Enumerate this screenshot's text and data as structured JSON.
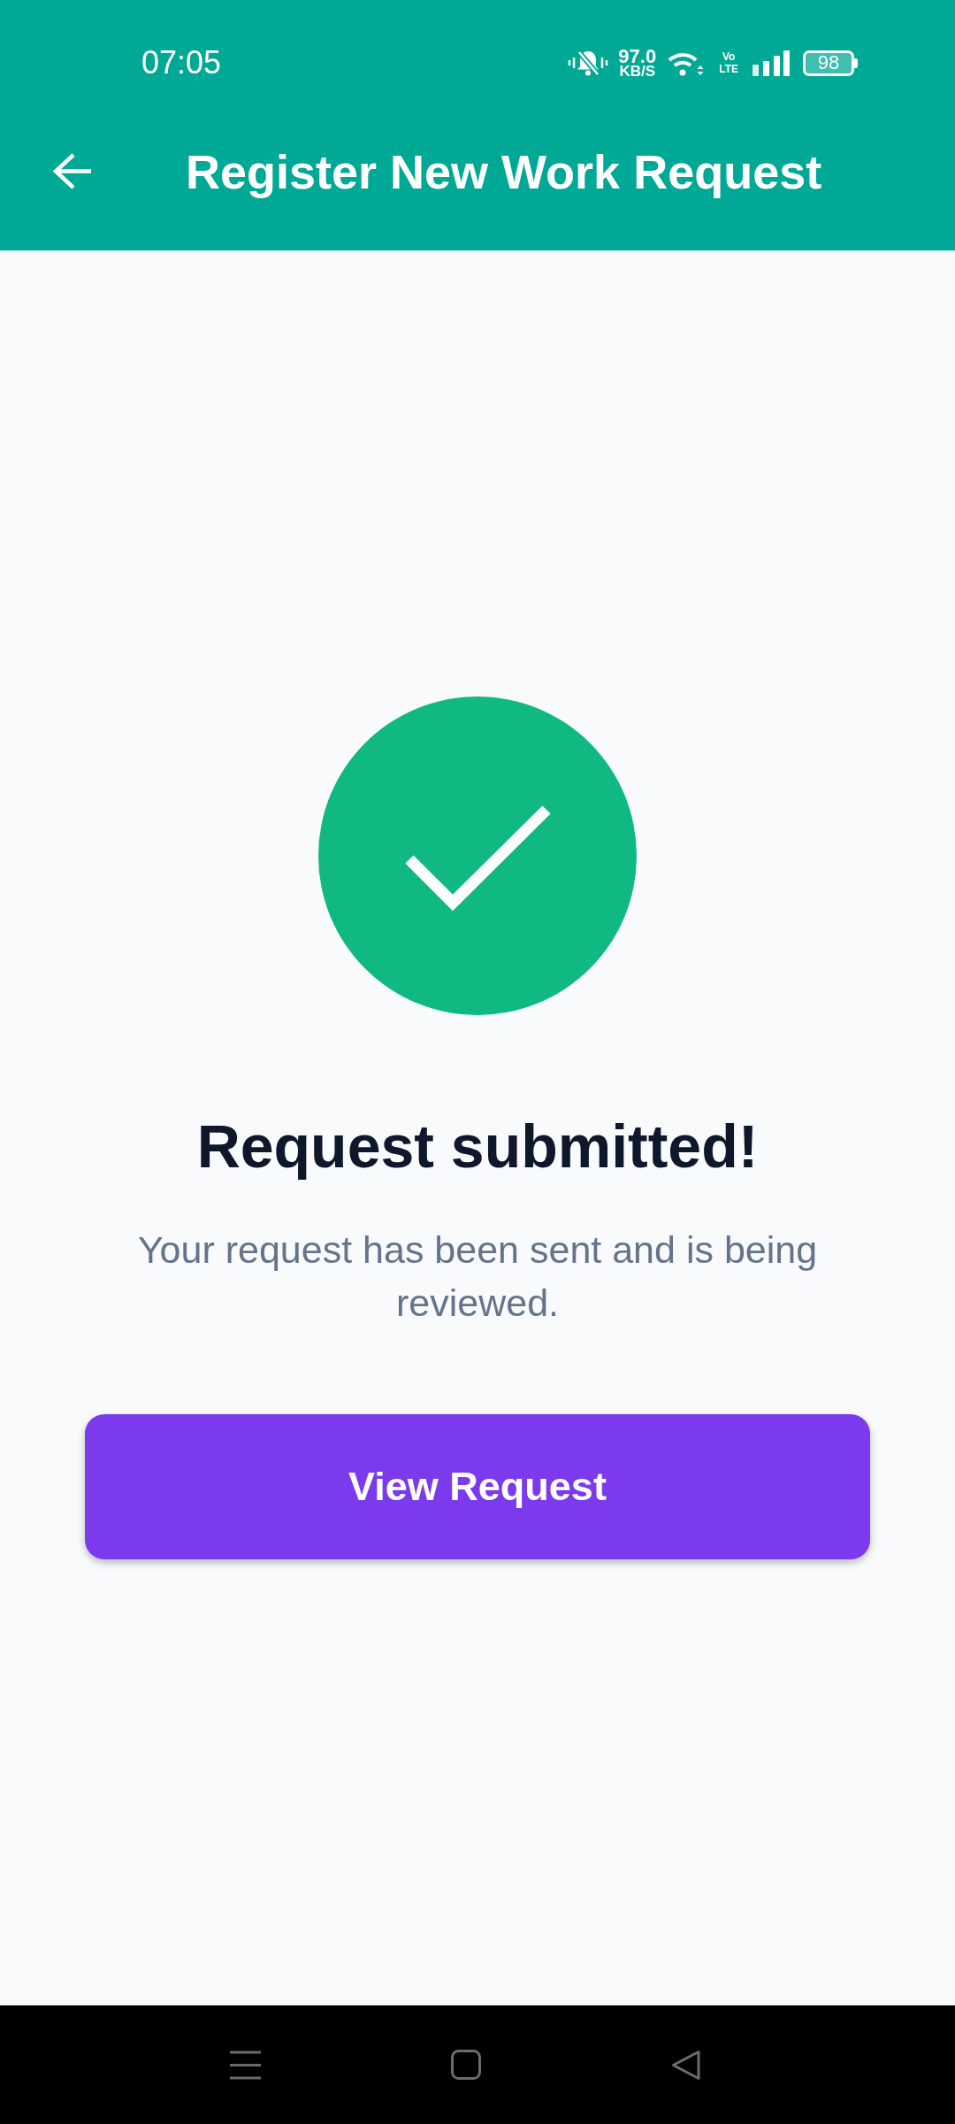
{
  "status_bar": {
    "time": "07:05",
    "network_speed": "97.0",
    "network_speed_unit": "KB/S",
    "volte": [
      "Vo",
      "LTE"
    ],
    "battery": "98"
  },
  "app_bar": {
    "title": "Register New Work Request"
  },
  "confirmation": {
    "heading": "Request submitted!",
    "message": "Your request has been sent and is being reviewed.",
    "button": "View Request"
  }
}
